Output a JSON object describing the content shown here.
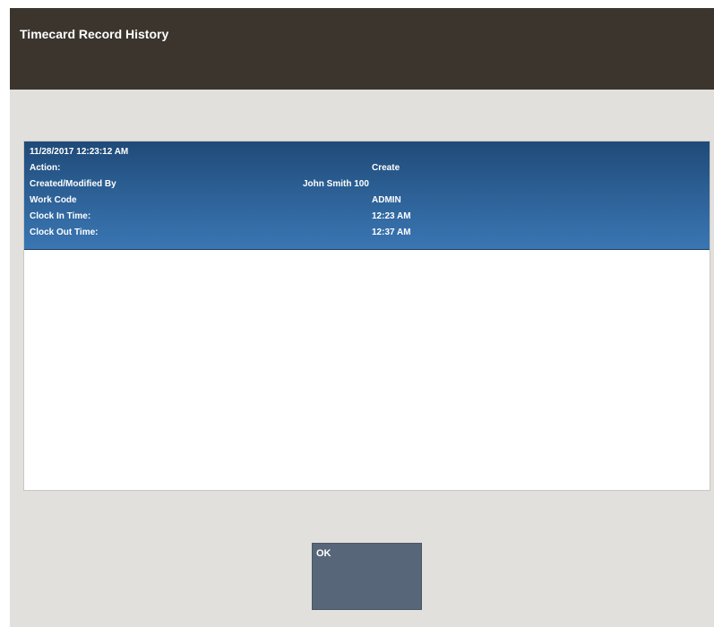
{
  "window": {
    "title": "Timecard Record History"
  },
  "records": [
    {
      "timestamp": "11/28/2017 12:23:12 AM",
      "rows": [
        {
          "label": "Action:",
          "value": "Create"
        },
        {
          "label": "Created/Modified By",
          "value": "John Smith 100"
        },
        {
          "label": "Work Code",
          "value": "ADMIN"
        },
        {
          "label": "Clock In Time:",
          "value": "12:23 AM"
        },
        {
          "label": "Clock Out Time:",
          "value": "12:37 AM"
        }
      ]
    }
  ],
  "footer": {
    "ok_label": "OK"
  },
  "colors": {
    "title_bar": "#3b352e",
    "background": "#e2e0dc",
    "record_highlight_top": "#1f4a78",
    "record_highlight_bottom": "#3a76b3",
    "ok_button": "#586679"
  }
}
